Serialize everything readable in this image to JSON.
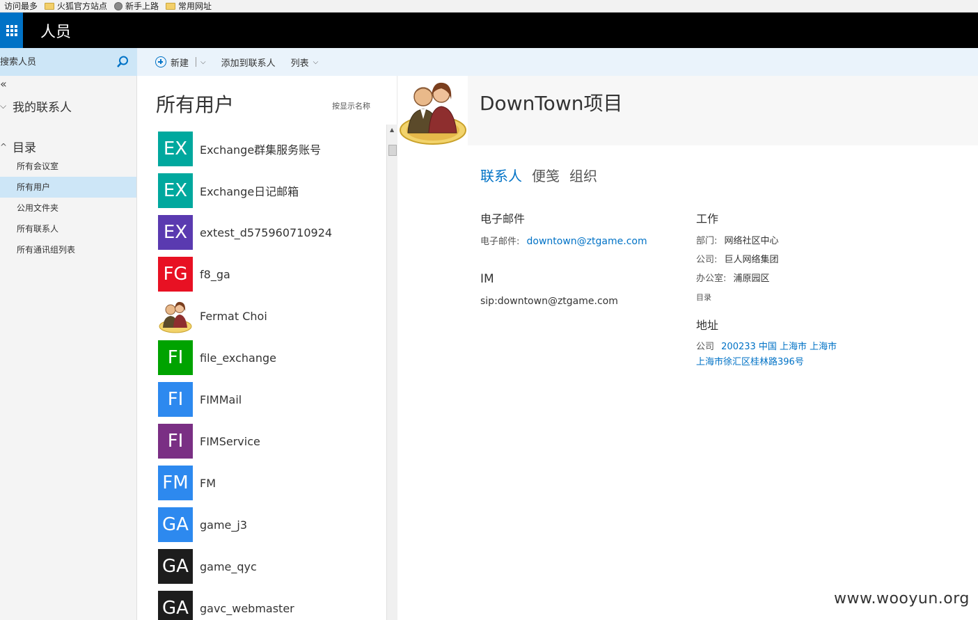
{
  "bookmarks": [
    {
      "label": "访问最多",
      "icon": "none"
    },
    {
      "label": "火狐官方站点",
      "icon": "folder-icon"
    },
    {
      "label": "新手上路",
      "icon": "globe-icon"
    },
    {
      "label": "常用网址",
      "icon": "folder-icon"
    }
  ],
  "app": {
    "title": "人员"
  },
  "search": {
    "placeholder": "搜索人员"
  },
  "nav": {
    "collapse": "«",
    "my_contacts": "我的联系人",
    "directory": "目录",
    "items": [
      "所有会议室",
      "所有用户",
      "公用文件夹",
      "所有联系人",
      "所有通讯组列表"
    ],
    "active_index": 1
  },
  "toolbar": {
    "new_label": "新建",
    "add_label": "添加到联系人",
    "list_label": "列表"
  },
  "list": {
    "title": "所有用户",
    "sort_label": "按显示名称",
    "contacts": [
      {
        "initials": "EX",
        "name": "Exchange群集服务账号",
        "color": "#00a89e"
      },
      {
        "initials": "EX",
        "name": "Exchange日记邮箱",
        "color": "#00a89e"
      },
      {
        "initials": "EX",
        "name": "extest_d575960710924",
        "color": "#5a3ab0"
      },
      {
        "initials": "FG",
        "name": "f8_ga",
        "color": "#e81123"
      },
      {
        "initials": "",
        "name": "Fermat Choi",
        "color": "#ffffff",
        "photo": true
      },
      {
        "initials": "FI",
        "name": "file_exchange",
        "color": "#00a300"
      },
      {
        "initials": "FI",
        "name": "FIMMail",
        "color": "#2d89ef"
      },
      {
        "initials": "FI",
        "name": "FIMService",
        "color": "#7a2f84"
      },
      {
        "initials": "FM",
        "name": "FM",
        "color": "#2d89ef"
      },
      {
        "initials": "GA",
        "name": "game_j3",
        "color": "#2d89ef"
      },
      {
        "initials": "GA",
        "name": "game_qyc",
        "color": "#1d1d1d"
      },
      {
        "initials": "GA",
        "name": "gavc_webmaster",
        "color": "#1d1d1d"
      }
    ]
  },
  "detail": {
    "name": "DownTown项目",
    "tabs": [
      "联系人",
      "便笺",
      "组织"
    ],
    "email_section": "电子邮件",
    "email_label": "电子邮件:",
    "email_value": "downtown@ztgame.com",
    "im_section": "IM",
    "im_value": "sip:downtown@ztgame.com",
    "work_section": "工作",
    "dept_label": "部门:",
    "dept_value": "网络社区中心",
    "company_label": "公司:",
    "company_value": "巨人网络集团",
    "office_label": "办公室:",
    "office_value": "浦原园区",
    "directory_note": "目录",
    "address_section": "地址",
    "address_type": "公司",
    "address_line1": "200233 中国 上海市 上海市",
    "address_line2": "上海市徐汇区桂林路396号"
  },
  "watermark": "www.wooyun.org",
  "colors": {
    "accent": "#0072c6",
    "nav_active": "#cde6f7"
  }
}
